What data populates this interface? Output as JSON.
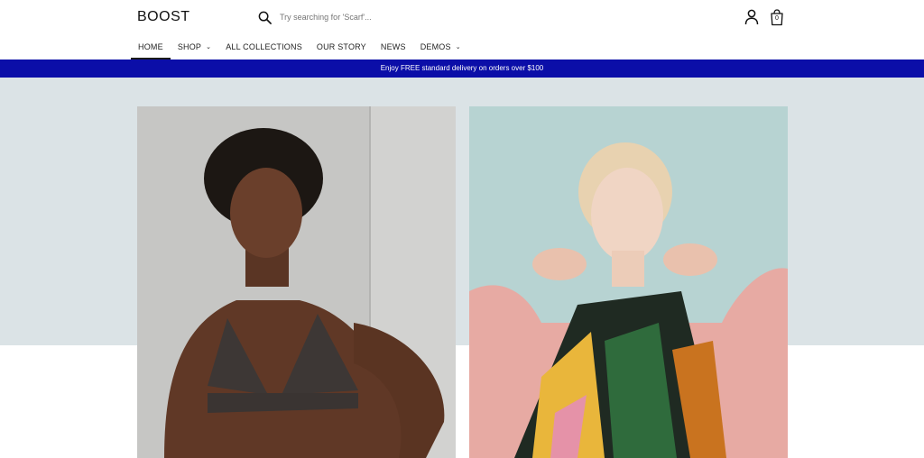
{
  "header": {
    "logo": "BOOST",
    "search_placeholder": "Try searching for 'Scarf'...",
    "cart_count": "0"
  },
  "nav": {
    "items": [
      {
        "label": "HOME",
        "active": true
      },
      {
        "label": "SHOP",
        "dropdown": true
      },
      {
        "label": "ALL COLLECTIONS"
      },
      {
        "label": "OUR STORY"
      },
      {
        "label": "NEWS"
      },
      {
        "label": "DEMOS",
        "dropdown": true
      }
    ]
  },
  "announcement": "Enjoy FREE standard delivery on orders over $100",
  "colors": {
    "announcement_bg": "#0b0ea8",
    "hero_band_bg": "#dbe3e6"
  },
  "icons": [
    "search-icon",
    "account-icon",
    "cart-icon",
    "chevron-down-icon"
  ]
}
